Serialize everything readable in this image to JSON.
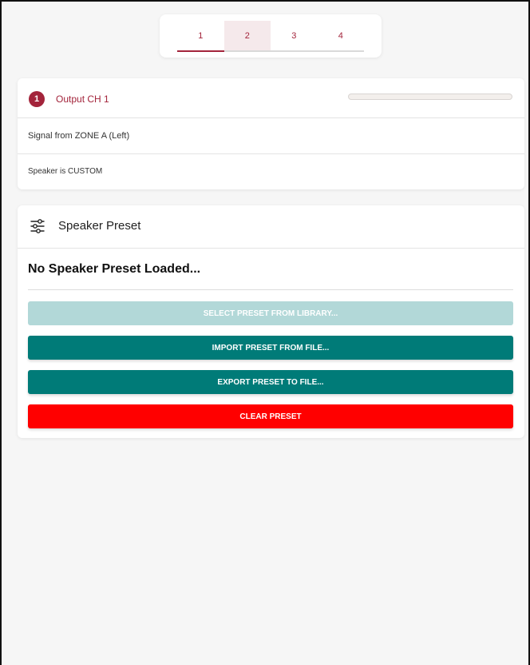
{
  "tabs": [
    {
      "label": "1",
      "active": true
    },
    {
      "label": "2",
      "active": false
    },
    {
      "label": "3",
      "active": false
    },
    {
      "label": "4",
      "active": false
    }
  ],
  "channel": {
    "number": "1",
    "title": "Output CH 1",
    "signal_source": "Signal from ZONE A (Left)",
    "speaker_status": "Speaker is CUSTOM",
    "level_meter": 0
  },
  "preset": {
    "header": "Speaker Preset",
    "status": "No Speaker Preset Loaded...",
    "buttons": {
      "select": "Select preset from library...",
      "import": "Import preset from file...",
      "export": "Export preset to file...",
      "clear": "Clear preset"
    }
  },
  "colors": {
    "accent": "#a3243b",
    "teal": "#007b78",
    "teal_disabled": "#b2d8d8",
    "danger": "#ff0000"
  },
  "icons": {
    "preset": "tune-sliders-icon"
  }
}
